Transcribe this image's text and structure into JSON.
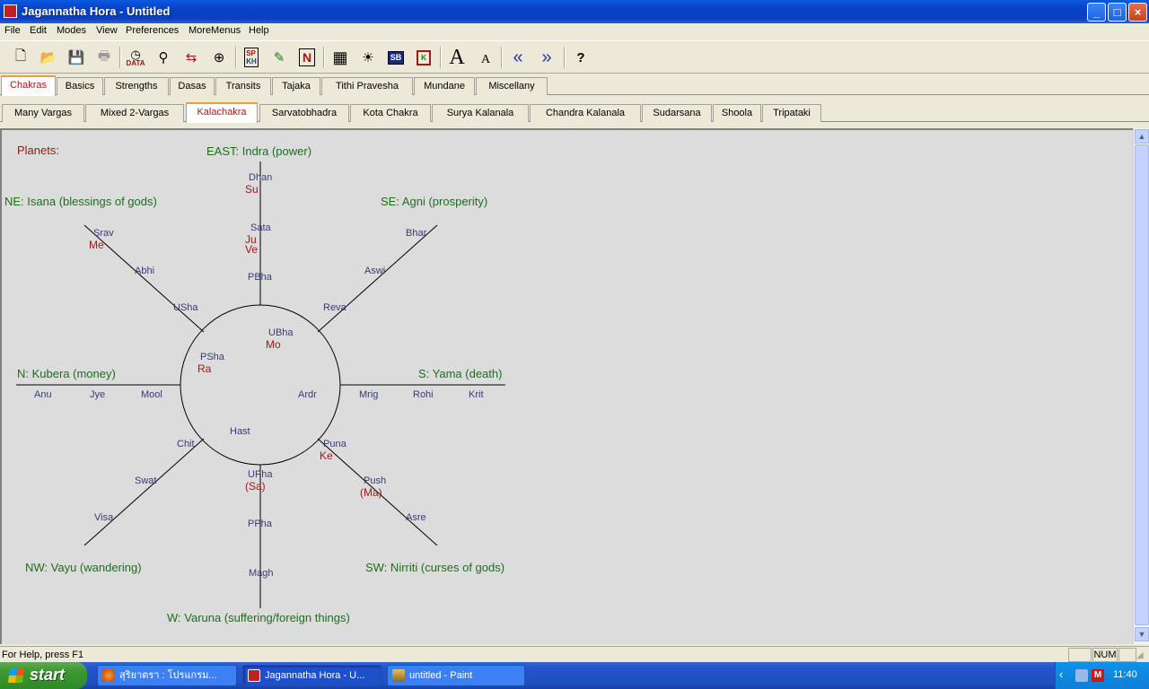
{
  "window": {
    "title": "Jagannatha Hora - Untitled"
  },
  "menu": [
    "File",
    "Edit",
    "Modes",
    "View",
    "Preferences",
    "MoreMenus",
    "Help"
  ],
  "toolbar": {
    "data_label": "DATA",
    "sp_label": "SP",
    "kh_label": "KH",
    "n_label": "N",
    "sb_label": "SB",
    "k_label": "K",
    "font_large": "A",
    "font_small": "A",
    "help_label": "?"
  },
  "tabs_main": [
    "Chakras",
    "Basics",
    "Strengths",
    "Dasas",
    "Transits",
    "Tajaka",
    "Tithi Pravesha",
    "Mundane",
    "Miscellany"
  ],
  "tabs_sub": [
    "Many Vargas",
    "Mixed 2-Vargas",
    "Kalachakra",
    "Sarvatobhadra",
    "Kota Chakra",
    "Surya Kalanala",
    "Chandra Kalanala",
    "Sudarsana",
    "Shoola",
    "Tripataki"
  ],
  "chart": {
    "planets_header": "Planets:",
    "directions": {
      "east": "EAST: Indra (power)",
      "ne": "NE: Isana (blessings of gods)",
      "se": "SE: Agni (prosperity)",
      "north": "N: Kubera (money)",
      "south": "S: Yama (death)",
      "nw": "NW: Vayu (wandering)",
      "sw": "SW: Nirriti (curses of gods)",
      "west": "W: Varuna (suffering/foreign things)"
    },
    "nakshatras": {
      "dhan": "Dhan",
      "sata": "Sata",
      "pbha": "PBha",
      "ubha": "UBha",
      "srav": "Srav",
      "abhi": "Abhi",
      "usha": "USha",
      "psha": "PSha",
      "bhar": "Bhar",
      "aswi": "Aswi",
      "reva": "Reva",
      "anu": "Anu",
      "jye": "Jye",
      "mool": "Mool",
      "ardr": "Ardr",
      "mrig": "Mrig",
      "rohi": "Rohi",
      "krit": "Krit",
      "hast": "Hast",
      "chit": "Chit",
      "swat": "Swat",
      "visa": "Visa",
      "upha": "UPha",
      "ppha": "PPha",
      "magh": "Magh",
      "puna": "Puna",
      "push": "Push",
      "asre": "Asre"
    },
    "planets": {
      "su": "Su",
      "ju": "Ju",
      "ve": "Ve",
      "me": "Me",
      "mo": "Mo",
      "ra": "Ra",
      "ke": "Ke",
      "sa": "(Sa)",
      "ma": "(Ma)"
    }
  },
  "status": {
    "message": "For Help, press F1",
    "num": "NUM"
  },
  "taskbar": {
    "start": "start",
    "tasks": [
      "สุริยาตรา : โปรแกรม...",
      "Jagannatha Hora - U...",
      "untitled - Paint"
    ],
    "clock": "11:40"
  },
  "colors": {
    "nakshatra": "#3a3a78",
    "planet": "#a01818",
    "direction": "#1e6e1e",
    "header": "#a01818"
  }
}
